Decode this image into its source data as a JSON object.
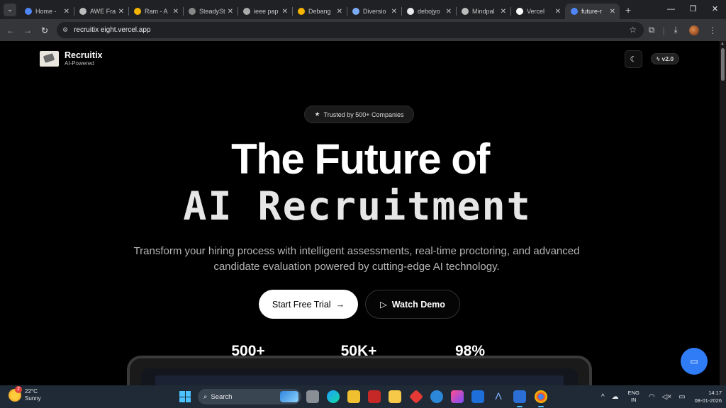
{
  "browser": {
    "tabs": [
      {
        "title": "Home -",
        "favicon_color": "#4f86f7",
        "active": false
      },
      {
        "title": "AWE Fra",
        "favicon_color": "#bbbbbb",
        "active": false
      },
      {
        "title": "Ram - A",
        "favicon_color": "#f4b400",
        "active": false
      },
      {
        "title": "SteadySt",
        "favicon_color": "#888888",
        "active": false
      },
      {
        "title": "ieee pap",
        "favicon_color": "#aaaaaa",
        "active": false
      },
      {
        "title": "Debang",
        "favicon_color": "#f4b400",
        "active": false
      },
      {
        "title": "Diversio",
        "favicon_color": "#7baaf7",
        "active": false
      },
      {
        "title": "debojyo",
        "favicon_color": "#e8eaed",
        "active": false
      },
      {
        "title": "Mindpal",
        "favicon_color": "#bbbbbb",
        "active": false
      },
      {
        "title": "Vercel",
        "favicon_color": "#ffffff",
        "active": false
      },
      {
        "title": "future-r",
        "favicon_color": "#4f86f7",
        "active": true
      }
    ],
    "new_tab_label": "+",
    "url": "recruitix eight.vercel.app"
  },
  "site": {
    "brand_name": "Recruitix",
    "brand_sub": "AI-Powered",
    "version_badge": "v2.0",
    "trust_badge": "Trusted by 500+ Companies",
    "headline_line1": "The Future of",
    "headline_line2": "AI Recruitment",
    "lede": "Transform your hiring process with intelligent assessments, real-time proctoring, and advanced candidate evaluation powered by cutting-edge AI technology.",
    "cta_primary": "Start Free Trial",
    "cta_secondary": "Watch Demo",
    "stats": [
      "500+",
      "50K+",
      "98%"
    ]
  },
  "taskbar": {
    "temperature": "22°C",
    "condition": "Sunny",
    "weather_badge": "2",
    "search_placeholder": "Search",
    "lang_line1": "ENG",
    "lang_line2": "IN",
    "time": "14:17",
    "date": "08-01-2026"
  },
  "colors": {
    "accent_blue": "#2f7cf6",
    "page_bg": "#000000",
    "taskbar_bg": "#1f2a36"
  }
}
